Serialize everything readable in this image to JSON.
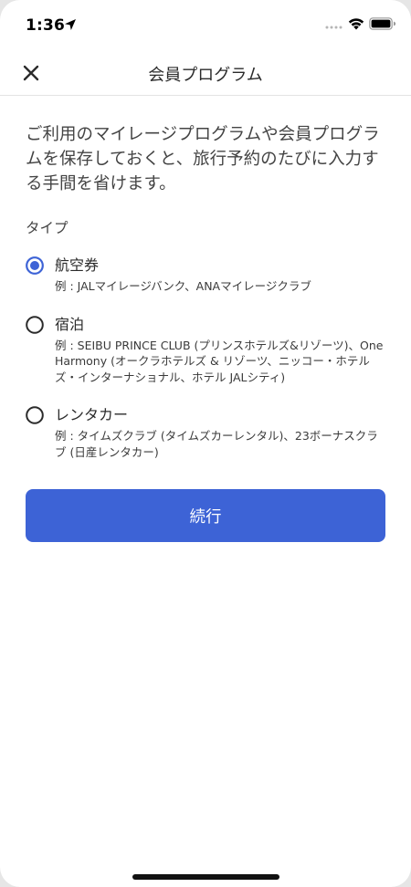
{
  "status_bar": {
    "time": "1:36"
  },
  "nav": {
    "title": "会員プログラム"
  },
  "intro_text": "ご利用のマイレージプログラムや会員プログラムを保存しておくと、旅行予約のたびに入力する手間を省けます。",
  "type_label": "タイプ",
  "options": [
    {
      "title": "航空券",
      "example": "例 : JALマイレージバンク、ANAマイレージクラブ",
      "selected": true
    },
    {
      "title": "宿泊",
      "example": "例 : SEIBU PRINCE CLUB (プリンスホテルズ&リゾーツ)、One Harmony (オークラホテルズ & リゾーツ、ニッコー・ホテルズ・インターナショナル、ホテル JALシティ)",
      "selected": false
    },
    {
      "title": "レンタカー",
      "example": "例 : タイムズクラブ (タイムズカーレンタル)、23ボーナスクラブ (日産レンタカー)",
      "selected": false
    }
  ],
  "continue_label": "続行",
  "colors": {
    "accent": "#3d63d6",
    "radio_unselected": "#2b2b2b"
  }
}
